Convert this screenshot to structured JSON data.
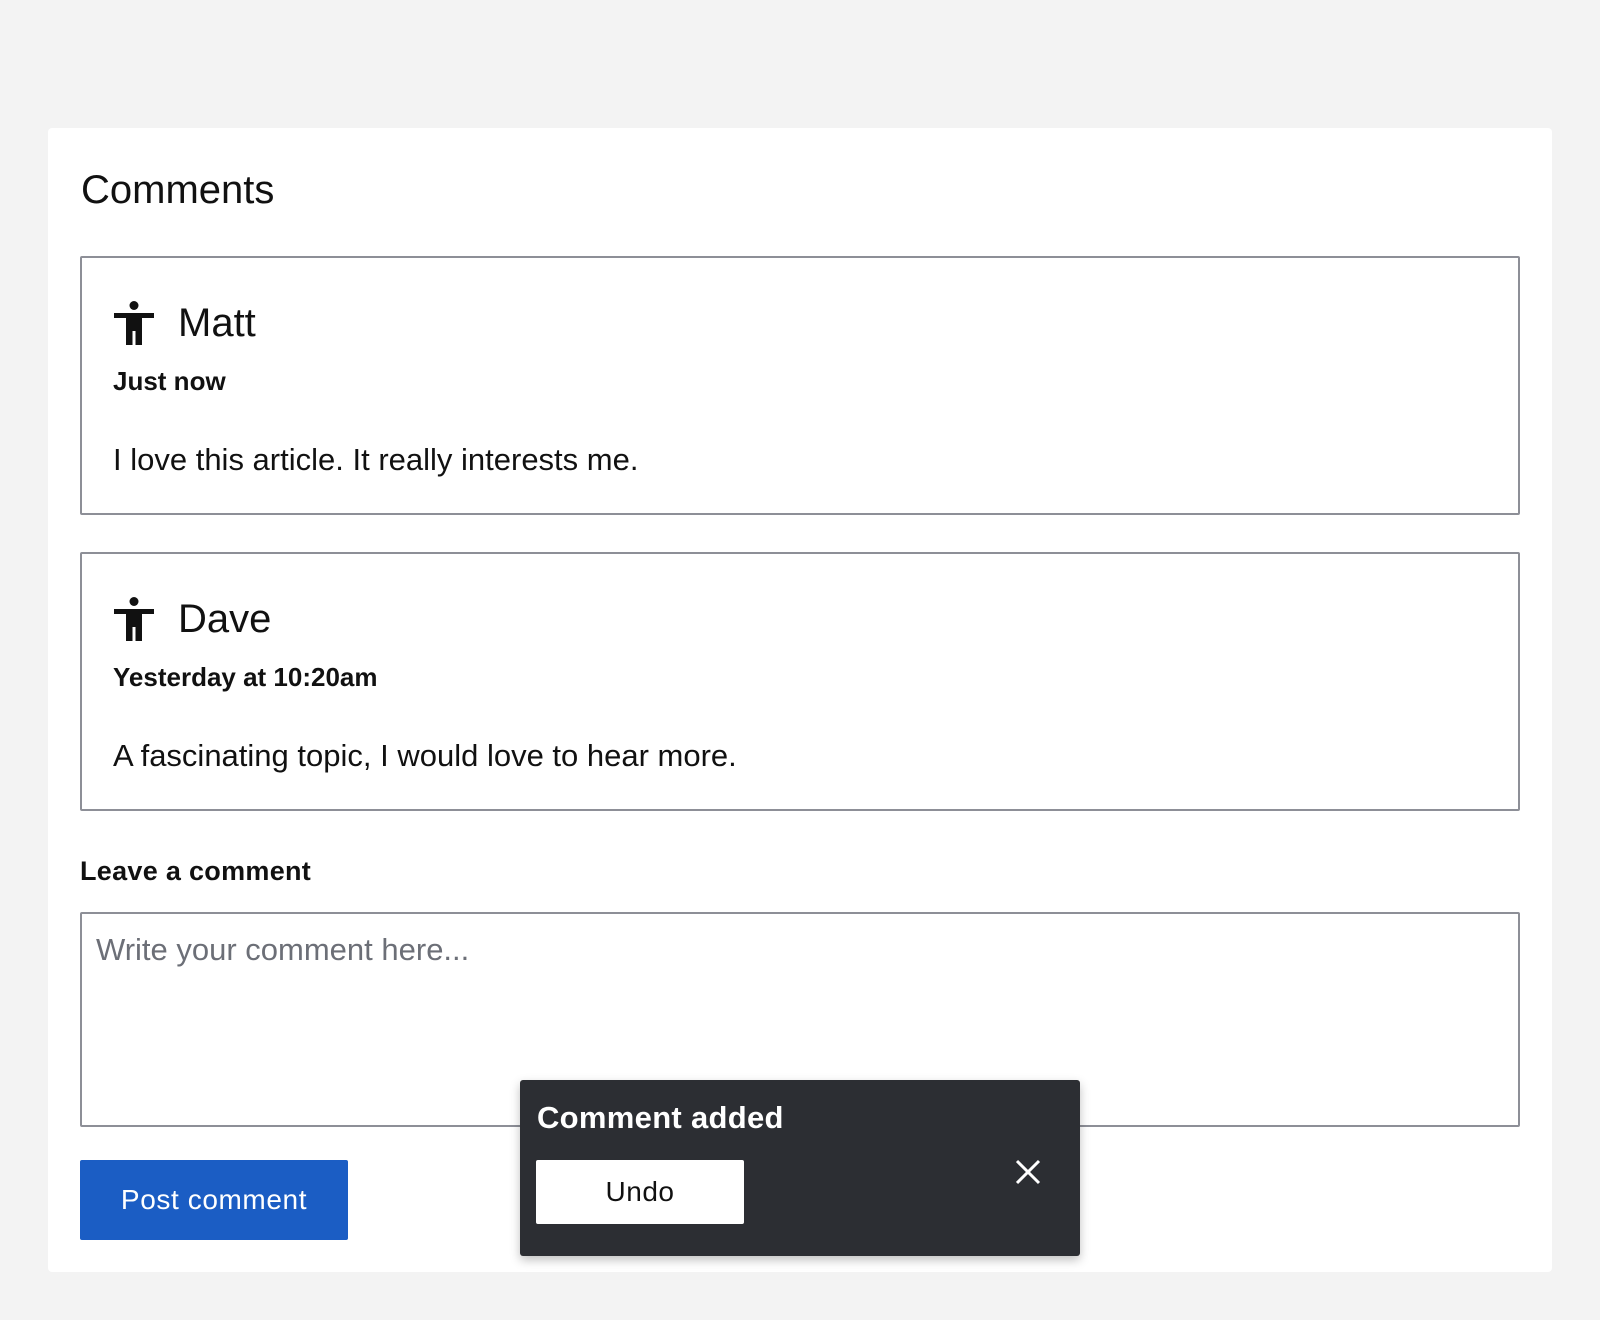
{
  "comments_section": {
    "title": "Comments",
    "items": [
      {
        "author": "Matt",
        "avatar_icon": "person-icon",
        "time": "Just now",
        "text": "I love this article. It really interests me."
      },
      {
        "author": "Dave",
        "avatar_icon": "person-icon",
        "time": "Yesterday at 10:20am",
        "text": "A fascinating topic, I would love to hear more."
      }
    ]
  },
  "comment_form": {
    "label": "Leave a comment",
    "value": "",
    "placeholder": "Write your comment here...",
    "submit_label": "Post comment"
  },
  "toast": {
    "message": "Comment added",
    "action_label": "Undo",
    "close_icon": "close-icon"
  },
  "colors": {
    "page_background": "#f3f3f3",
    "card_background": "#ffffff",
    "border": "#8d8f97",
    "primary_button": "#1b5dc4",
    "toast_background": "#2c2e33"
  }
}
